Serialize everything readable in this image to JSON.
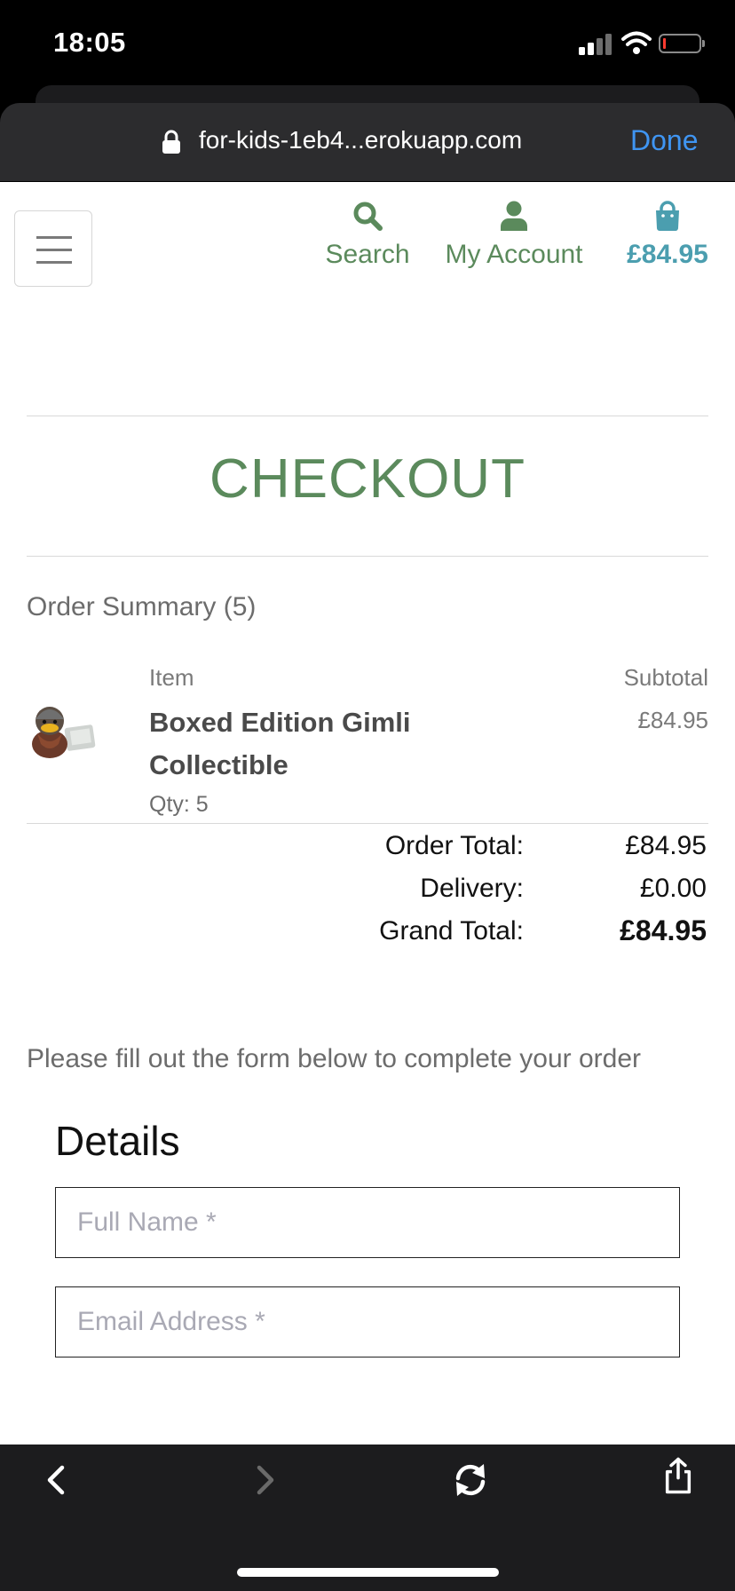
{
  "status_bar": {
    "time": "18:05"
  },
  "browser": {
    "url": "for-kids-1eb4...erokuapp.com",
    "done_label": "Done",
    "toolbar_icons": [
      "back-icon",
      "forward-icon",
      "reload-icon",
      "share-icon"
    ]
  },
  "header": {
    "menu_icon": "hamburger-icon",
    "search_label": "Search",
    "account_label": "My Account",
    "bag_total": "£84.95",
    "accent_green": "#5b8a5c",
    "accent_teal": "#4b9eaf"
  },
  "checkout": {
    "title": "CHECKOUT",
    "summary_title": "Order Summary (5)",
    "col_item": "Item",
    "col_subtotal": "Subtotal",
    "item": {
      "name": "Boxed Edition Gimli Collectible",
      "qty": "Qty: 5",
      "subtotal": "£84.95"
    },
    "totals": {
      "order_total_label": "Order Total:",
      "order_total": "£84.95",
      "delivery_label": "Delivery:",
      "delivery": "£0.00",
      "grand_total_label": "Grand Total:",
      "grand_total": "£84.95"
    },
    "form_note": "Please fill out the form below to complete your order",
    "details_heading": "Details",
    "full_name_placeholder": "Full Name *",
    "email_placeholder": "Email Address *",
    "full_name_value": "",
    "email_value": ""
  }
}
